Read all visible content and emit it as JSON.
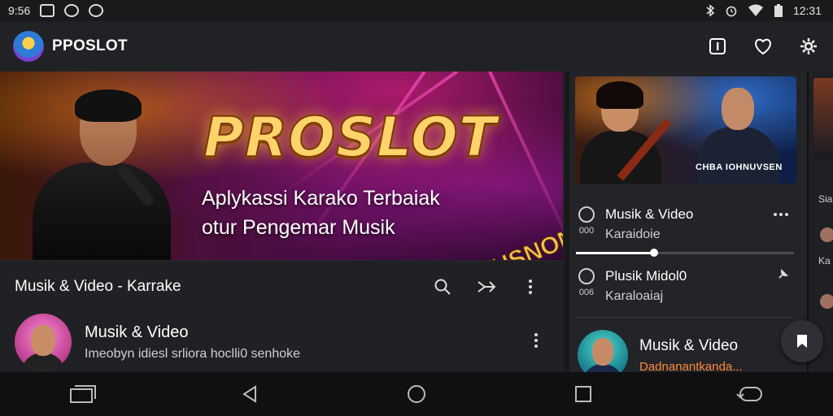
{
  "status_bar": {
    "left_time": "9:56",
    "right_time": "12:31"
  },
  "app": {
    "title": "PPOSLOT"
  },
  "hero": {
    "title": "PROSLOT",
    "subtitle_line1": "Aplykassi Karako Terbaiak",
    "subtitle_line2": "otur Pengemar Musik",
    "badge": "KUSNON"
  },
  "section": {
    "title": "Musik & Video - Karrake"
  },
  "list_item": {
    "title": "Musik & Video",
    "description": "Imeobyn idiesl srliora hoclli0 senhoke"
  },
  "side": {
    "thumb_caption": "CHBA IOHNUVSEN",
    "row1": {
      "title": "Musik & Video",
      "sub": "Karaidoie",
      "num": "000"
    },
    "row2": {
      "title": "Plusik Midol0",
      "sub": "Karaloaiaj",
      "num": "006"
    },
    "progress": 0.36,
    "bottom": {
      "title": "Musik & Video",
      "sub": "Dadnanantkanda..."
    },
    "far_text_1": "Sia",
    "far_text_2": "Ka"
  },
  "colors": {
    "accent": "#ff8a3a",
    "gold": "#ffd36b",
    "background": "#202124"
  },
  "icons": [
    "bluetooth-icon",
    "alarm-icon",
    "wifi-icon",
    "battery-icon",
    "info-icon",
    "heart-icon",
    "settings-icon",
    "search-icon",
    "share-icon",
    "more-icon",
    "pin-icon",
    "bookmark-icon",
    "recents-icon",
    "back-icon",
    "home-icon",
    "overview-icon",
    "rotate-icon"
  ]
}
